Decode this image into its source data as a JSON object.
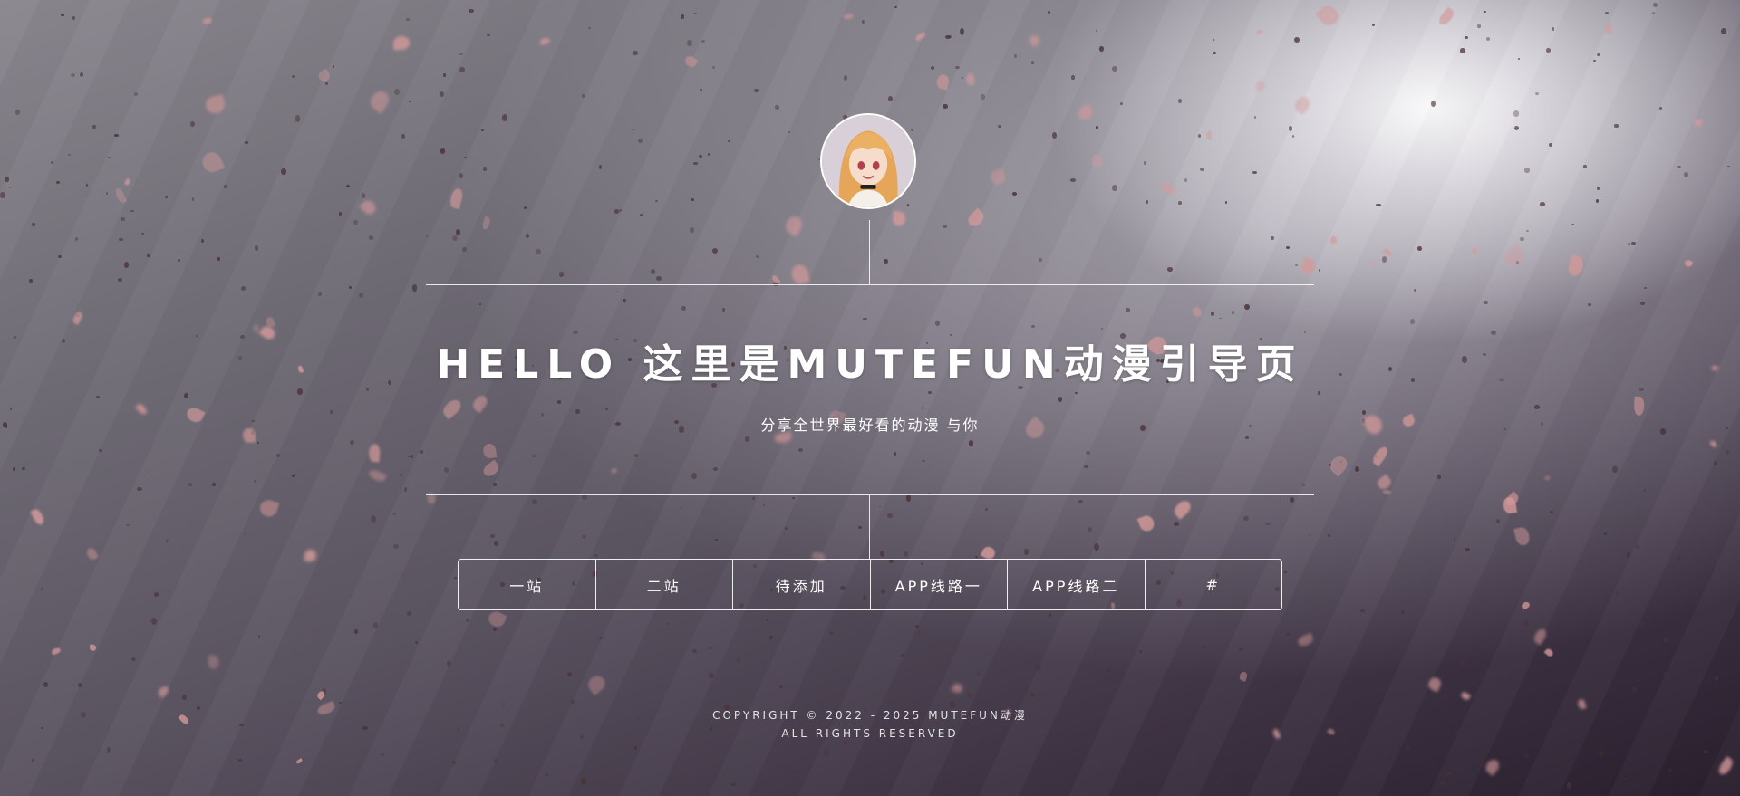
{
  "hero": {
    "title": "HELLO 这里是MUTEFUN动漫引导页",
    "subtitle": "分享全世界最好看的动漫 与你"
  },
  "nav": {
    "items": [
      {
        "label": "一站"
      },
      {
        "label": "二站"
      },
      {
        "label": "待添加"
      },
      {
        "label": "APP线路一"
      },
      {
        "label": "APP线路二"
      },
      {
        "label": "#"
      }
    ]
  },
  "footer": {
    "copyright_line1": "COPYRIGHT © 2022 - 2025 MUTEFUN动漫",
    "copyright_line2": "ALL RIGHTS RESERVED"
  },
  "colors": {
    "text": "#ffffff",
    "petal": "#d49a9a",
    "background_dark": "#2a1f2d",
    "background_light": "#e9e7ec"
  },
  "icons": {
    "avatar": "anime-avatar"
  }
}
